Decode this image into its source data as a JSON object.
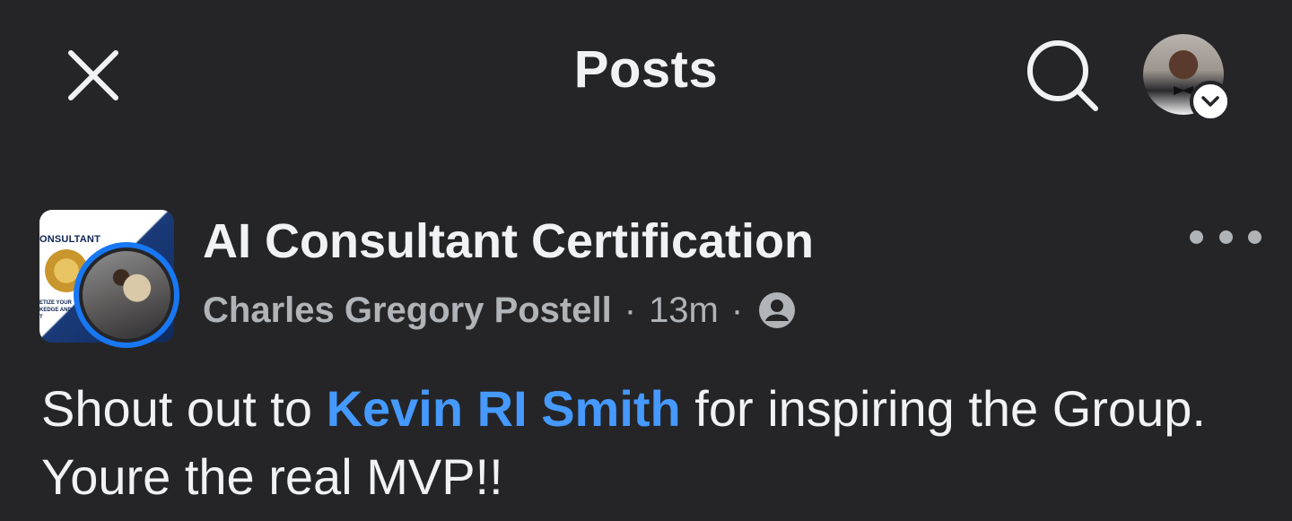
{
  "header": {
    "title": "Posts",
    "close_icon": "close-icon",
    "search_icon": "search-icon",
    "profile_menu_icon": "chevron-down-icon"
  },
  "post": {
    "group_name": "AI Consultant Certification",
    "group_cover_text": "ONSULTANT",
    "group_cover_subtext": "ETIZE YOUR KEDGE AND T",
    "author": "Charles Gregory Postell",
    "separator": "·",
    "time": "13m",
    "audience_icon": "members-icon",
    "more_icon": "more-options-icon",
    "body_prefix": "Shout out to ",
    "mention": "Kevin RI Smith",
    "body_suffix": " for inspiring the Group. Youre the real MVP!!"
  },
  "colors": {
    "background": "#252528",
    "text_primary": "#f0f2f5",
    "text_secondary": "#b0b3b8",
    "mention": "#4599ff",
    "story_ring": "#1877f2"
  }
}
